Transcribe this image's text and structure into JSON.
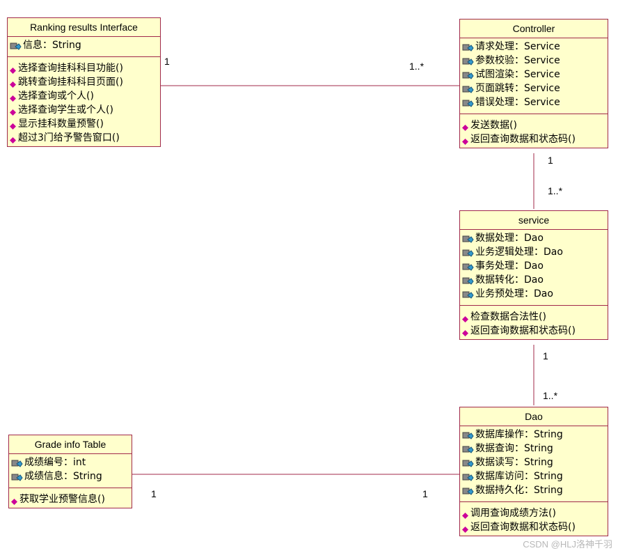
{
  "classes": {
    "ranking": {
      "name": "Ranking results Interface",
      "attributes": [
        "信息：String"
      ],
      "operations": [
        "选择查询挂科科目功能()",
        "跳转查询挂科科目页面()",
        "选择查询或个人()",
        "选择查询学生或个人()",
        "显示挂科数量预警()",
        "超过3门给予警告窗口()"
      ]
    },
    "controller": {
      "name": "Controller",
      "attributes": [
        "请求处理：Service",
        "参数校验：Service",
        "试图渲染：Service",
        "页面跳转：Service",
        "错误处理：Service"
      ],
      "operations": [
        "发送数据()",
        "返回查询数据和状态码()"
      ]
    },
    "service": {
      "name": "service",
      "attributes": [
        "数据处理：Dao",
        "业务逻辑处理：Dao",
        "事务处理：Dao",
        "数据转化：Dao",
        "业务预处理：Dao"
      ],
      "operations": [
        "检查数据合法性()",
        "返回查询数据和状态码()"
      ]
    },
    "dao": {
      "name": "Dao",
      "attributes": [
        "数据库操作：String",
        "数据查询：String",
        "数据读写：String",
        "数据库访问：String",
        "数据持久化：String"
      ],
      "operations": [
        "调用查询成绩方法()",
        "返回查询数据和状态码()"
      ]
    },
    "grade": {
      "name": "Grade info Table",
      "attributes": [
        "成绩编号：int",
        "成绩信息：String"
      ],
      "operations": [
        "获取学业预警信息()"
      ]
    }
  },
  "multiplicities": {
    "ranking_controller_left": "1",
    "ranking_controller_right": "1..*",
    "controller_service_top": "1",
    "controller_service_bottom": "1..*",
    "service_dao_top": "1",
    "service_dao_bottom": "1..*",
    "grade_dao_left": "1",
    "grade_dao_right": "1"
  },
  "watermark": "CSDN @HLJ洛神千羽",
  "colors": {
    "class_fill": "#ffffcc",
    "class_border": "#a0284a",
    "op_icon": "#cc0099",
    "attr_icon": "#3399cc"
  }
}
